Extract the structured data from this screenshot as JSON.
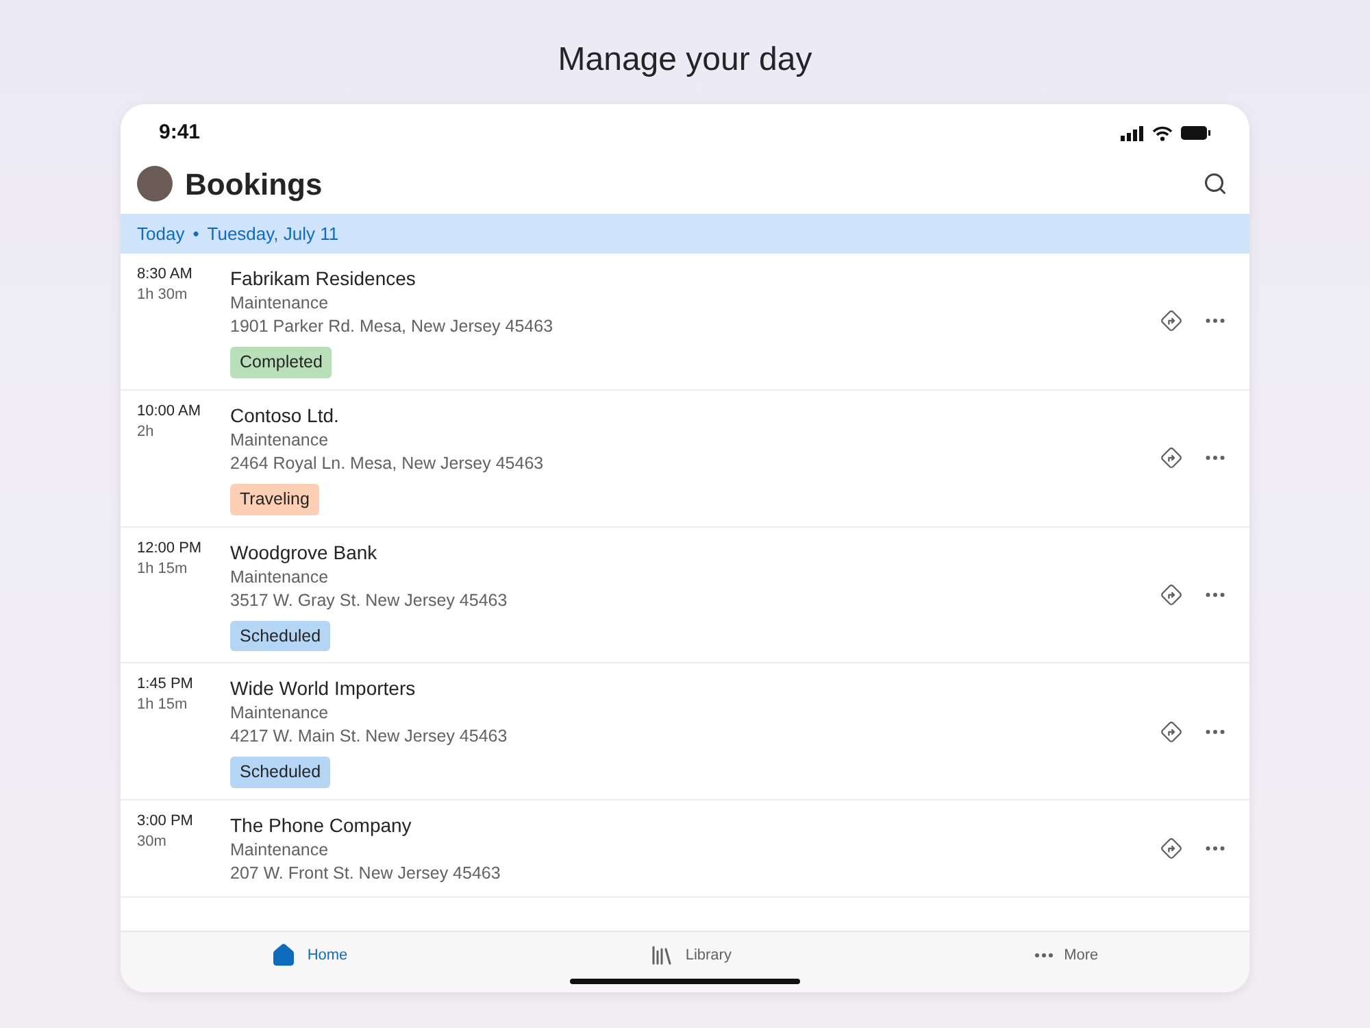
{
  "page_title": "Manage your day",
  "status_bar": {
    "time": "9:41"
  },
  "header": {
    "title": "Bookings"
  },
  "date_banner": {
    "today": "Today",
    "separator": "•",
    "date": "Tuesday, July 11"
  },
  "bookings": [
    {
      "time": "8:30 AM",
      "duration": "1h 30m",
      "name": "Fabrikam Residences",
      "type": "Maintenance",
      "address": "1901 Parker Rd. Mesa, New Jersey 45463",
      "status": "Completed",
      "color": "#b9dfb9"
    },
    {
      "time": "10:00 AM",
      "duration": "2h",
      "name": "Contoso Ltd.",
      "type": "Maintenance",
      "address": "2464 Royal Ln. Mesa, New Jersey 45463",
      "status": "Traveling",
      "color": "#fdcfb4"
    },
    {
      "time": "12:00 PM",
      "duration": "1h 15m",
      "name": "Woodgrove Bank",
      "type": "Maintenance",
      "address": "3517 W. Gray St. New Jersey 45463",
      "status": "Scheduled",
      "color": "#b4d6f4"
    },
    {
      "time": "1:45 PM",
      "duration": "1h 15m",
      "name": "Wide World Importers",
      "type": "Maintenance",
      "address": "4217 W. Main St. New Jersey 45463",
      "status": "Scheduled",
      "color": "#b4d6f4"
    },
    {
      "time": "3:00 PM",
      "duration": "30m",
      "name": "The Phone Company",
      "type": "Maintenance",
      "address": "207 W. Front St. New Jersey 45463"
    }
  ],
  "tab_bar": [
    {
      "kind": "home",
      "label": "Home",
      "selected": true
    },
    {
      "kind": "library",
      "label": "Library",
      "selected": false
    },
    {
      "kind": "more",
      "label": "More",
      "selected": false
    }
  ]
}
